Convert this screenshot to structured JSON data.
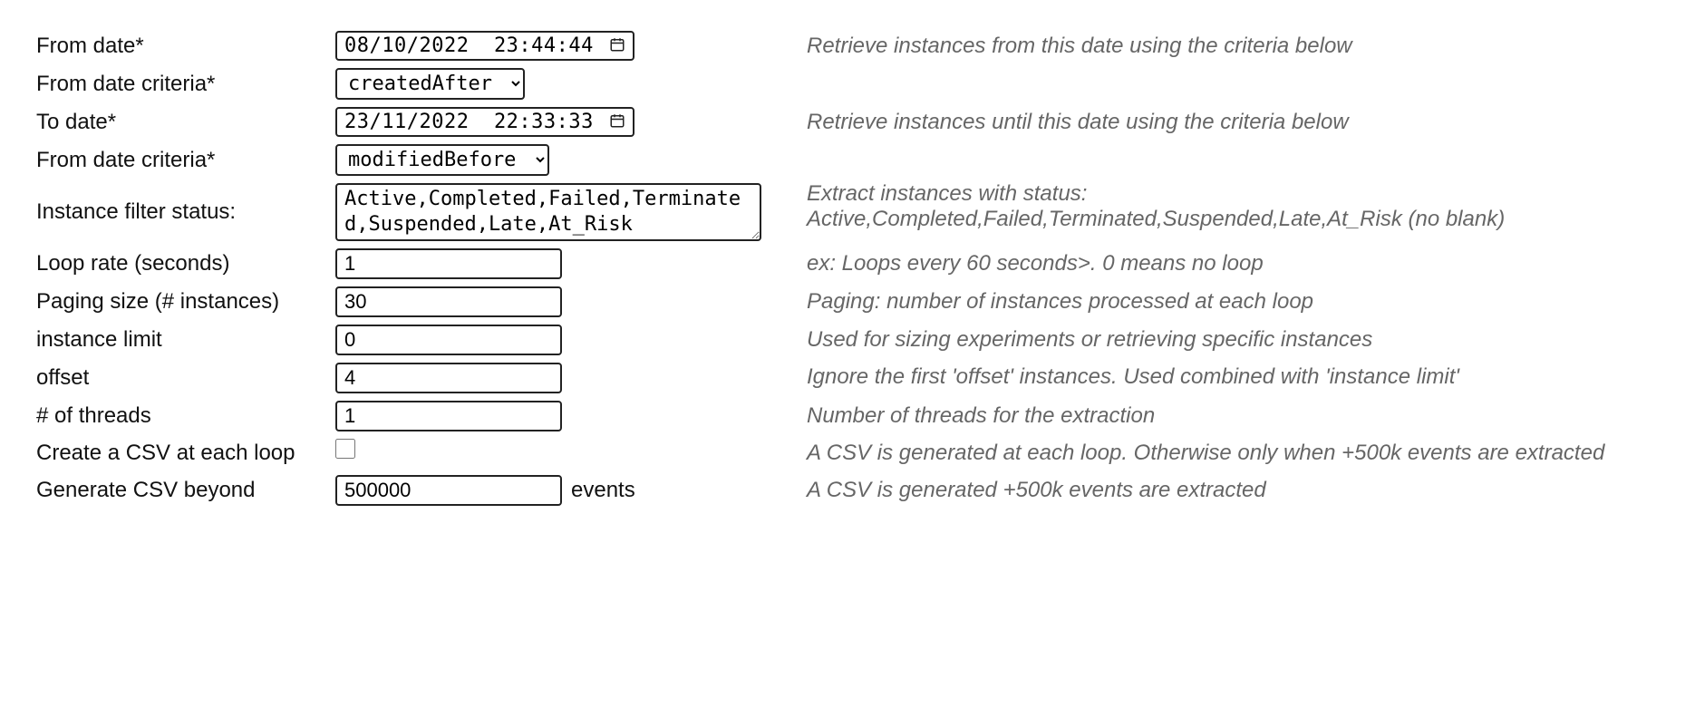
{
  "rows": {
    "fromDate": {
      "label": "From date*",
      "value": "08/10/2022  23:44:44",
      "hint": "Retrieve instances from this date using the criteria below"
    },
    "fromCriteria": {
      "label": "From date criteria*",
      "value": "createdAfter"
    },
    "toDate": {
      "label": "To date*",
      "value": "23/11/2022  22:33:33",
      "hint": "Retrieve instances until this date using the criteria below"
    },
    "toCriteria": {
      "label": "From date criteria*",
      "value": "modifiedBefore"
    },
    "status": {
      "label": "Instance filter status:",
      "value": "Active,Completed,Failed,Terminated,Suspended,Late,At_Risk",
      "hint": "Extract instances with status: Active,Completed,Failed,Terminated,Suspended,Late,At_Risk (no blank)"
    },
    "loopRate": {
      "label": "Loop rate (seconds)",
      "value": "1",
      "hint": "ex: Loops every 60 seconds>. 0 means no loop"
    },
    "pagingSize": {
      "label": "Paging size (# instances)",
      "value": "30",
      "hint": "Paging: number of instances processed at each loop"
    },
    "instanceLimit": {
      "label": "instance limit",
      "value": "0",
      "hint": "Used for sizing experiments or retrieving specific instances"
    },
    "offset": {
      "label": "offset",
      "value": "4",
      "hint": "Ignore the first 'offset' instances. Used combined with 'instance limit'"
    },
    "threads": {
      "label": "# of threads",
      "value": "1",
      "hint": "Number of threads for the extraction"
    },
    "csvEachLoop": {
      "label": "Create a CSV at each loop",
      "checked": false,
      "hint": "A CSV is generated at each loop. Otherwise only when +500k events are extracted"
    },
    "csvBeyond": {
      "label": "Generate CSV beyond",
      "value": "500000",
      "suffix": "events",
      "hint": "A CSV is generated +500k events are extracted"
    }
  }
}
